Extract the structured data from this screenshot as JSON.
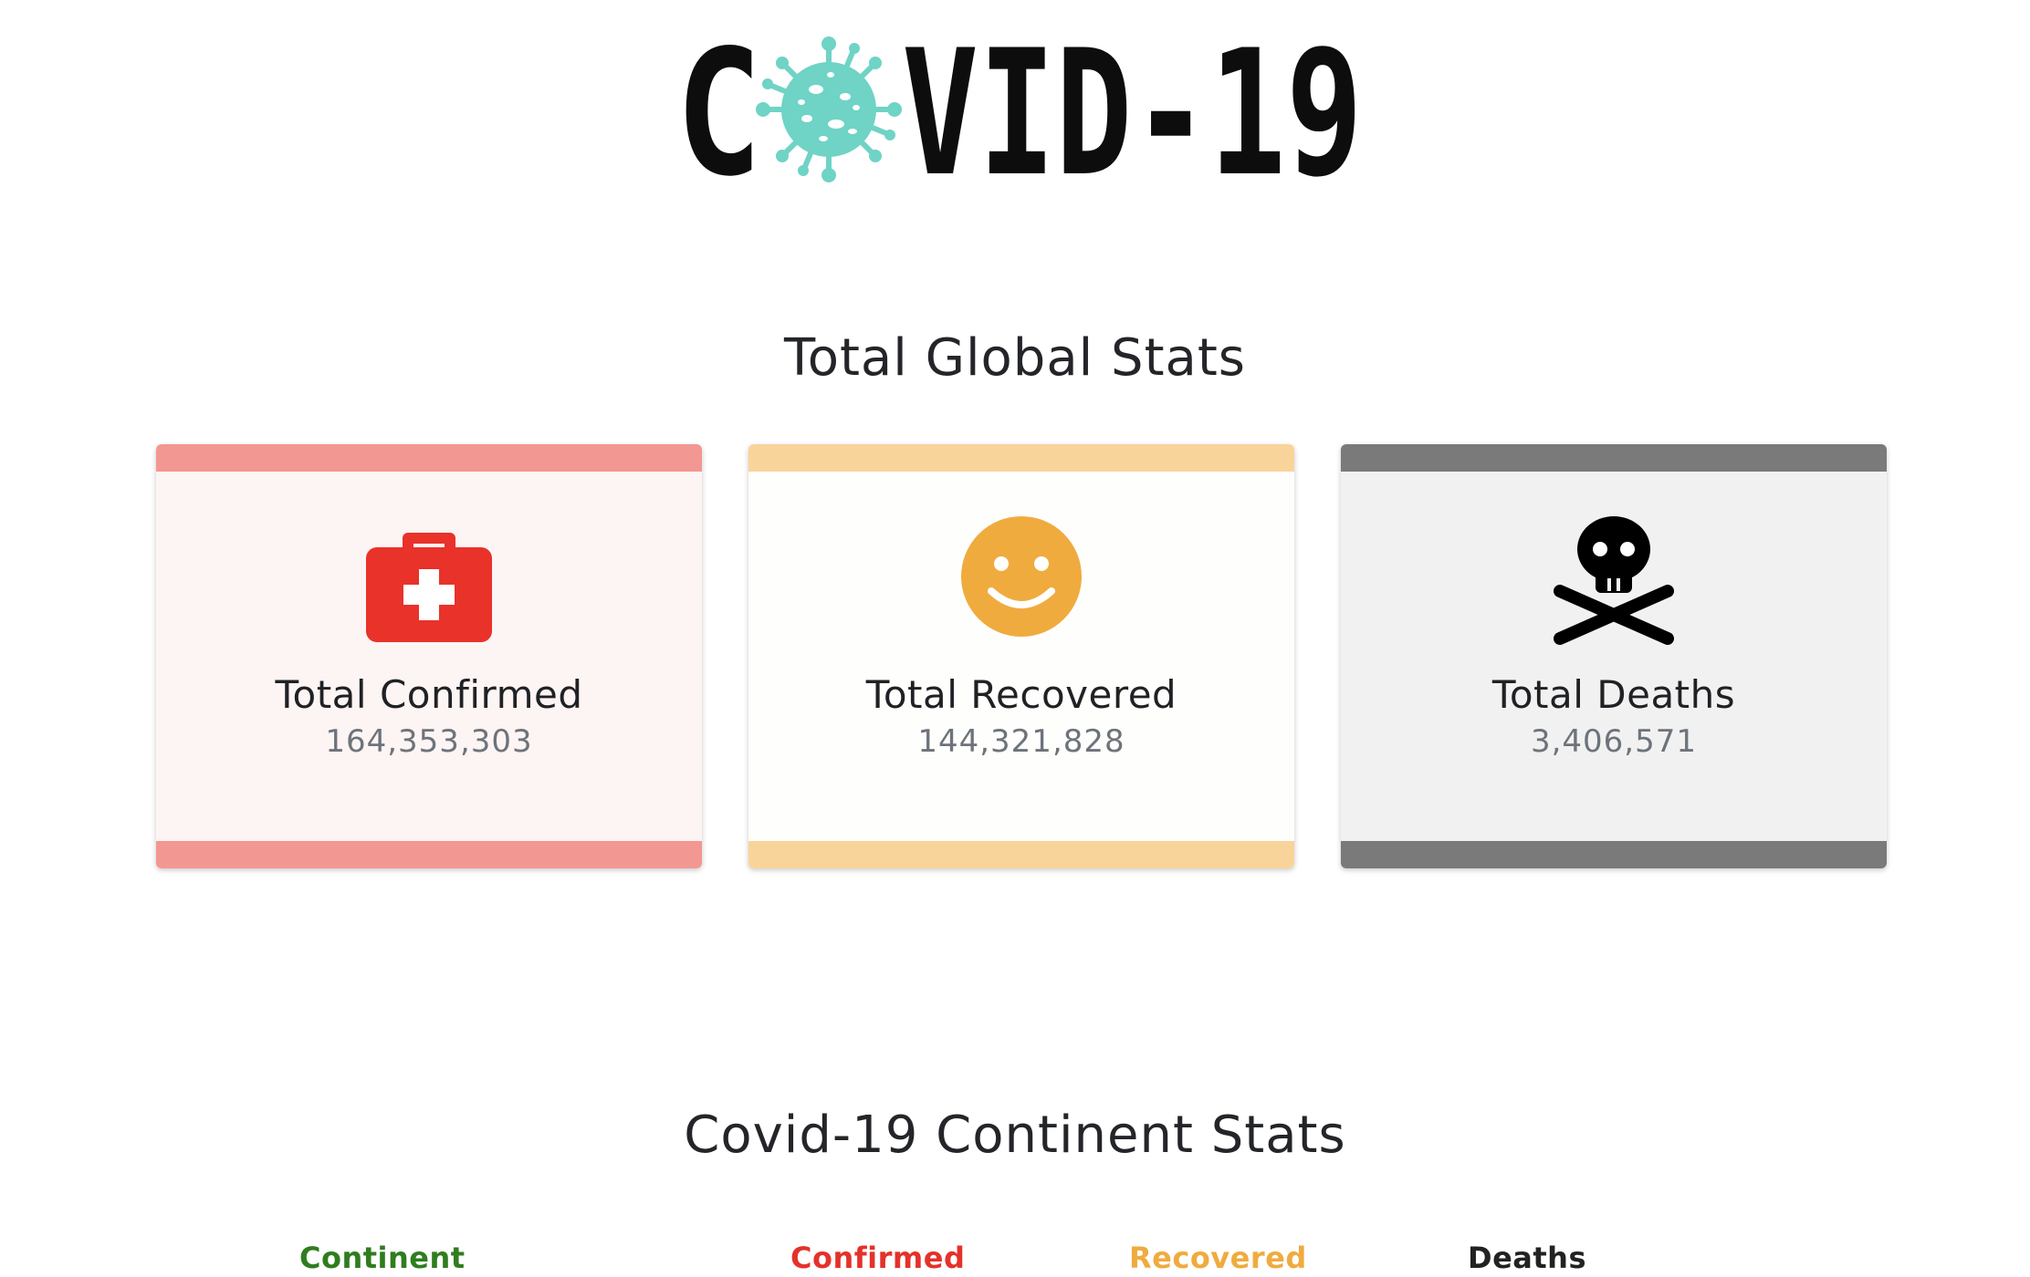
{
  "logo": {
    "text_left": "C",
    "text_right": "VID-19",
    "virus_color": "#6fd3c5",
    "text_color": "#0d0d0d"
  },
  "global_section": {
    "title": "Total Global Stats"
  },
  "cards": {
    "confirmed": {
      "label": "Total Confirmed",
      "value": "164,353,303",
      "icon": "first-aid-kit-icon",
      "accent": "#f39792",
      "icon_color": "#e8322a"
    },
    "recovered": {
      "label": "Total Recovered",
      "value": "144,321,828",
      "icon": "smiley-face-icon",
      "accent": "#f9d49a",
      "icon_color": "#f0ab3f"
    },
    "deaths": {
      "label": "Total Deaths",
      "value": "3,406,571",
      "icon": "skull-crossbones-icon",
      "accent": "#7a7a7a",
      "icon_color": "#000000"
    }
  },
  "continent_section": {
    "title": "Covid-19 Continent Stats",
    "columns": {
      "continent": "Continent",
      "confirmed": "Confirmed",
      "recovered": "Recovered",
      "deaths": "Deaths"
    },
    "column_colors": {
      "continent": "#2f7d1e",
      "confirmed": "#e4322a",
      "recovered": "#f0ab3f",
      "deaths": "#222222"
    }
  }
}
